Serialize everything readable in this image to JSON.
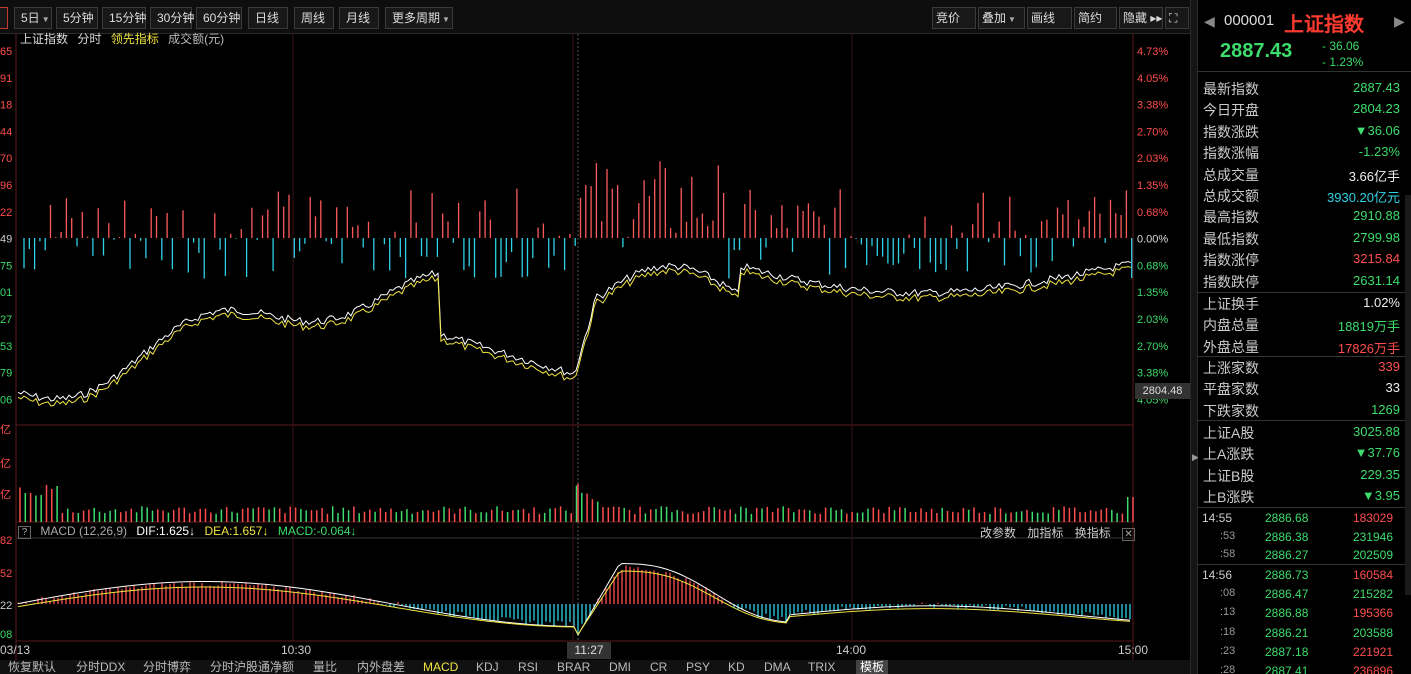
{
  "toolbar": {
    "periods": [
      {
        "label": "5日",
        "caret": true
      },
      {
        "label": "5分钟"
      },
      {
        "label": "15分钟"
      },
      {
        "label": "30分钟"
      },
      {
        "label": "60分钟"
      },
      {
        "label": "日线"
      },
      {
        "label": "周线"
      },
      {
        "label": "月线"
      },
      {
        "label": "更多周期",
        "caret": true
      }
    ],
    "right_tools": [
      {
        "label": "竞价"
      },
      {
        "label": "叠加",
        "caret": true
      },
      {
        "label": "画线"
      },
      {
        "label": "简约"
      },
      {
        "label": "隐藏 ▸▸"
      },
      {
        "label": "⛶"
      }
    ]
  },
  "legend": {
    "name": "上证指数",
    "mode": "分时",
    "leading": "领先指标",
    "volume": "成交额(元)"
  },
  "price_axis_left": [
    "65",
    "91",
    "18",
    "44",
    "70",
    "96",
    "22",
    "49",
    "75",
    "01",
    "27",
    "53",
    "79",
    "06"
  ],
  "pct_axis_right": [
    {
      "v": "4.73%",
      "c": "#ff4d4d"
    },
    {
      "v": "4.05%",
      "c": "#ff4d4d"
    },
    {
      "v": "3.38%",
      "c": "#ff4d4d"
    },
    {
      "v": "2.70%",
      "c": "#ff4d4d"
    },
    {
      "v": "2.03%",
      "c": "#ff4d4d"
    },
    {
      "v": "1.35%",
      "c": "#ff4d4d"
    },
    {
      "v": "0.68%",
      "c": "#ff4d4d"
    },
    {
      "v": "0.00%",
      "c": "#dddddd"
    },
    {
      "v": "0.68%",
      "c": "#3ddc6c"
    },
    {
      "v": "1.35%",
      "c": "#3ddc6c"
    },
    {
      "v": "2.03%",
      "c": "#3ddc6c"
    },
    {
      "v": "2.70%",
      "c": "#3ddc6c"
    },
    {
      "v": "3.38%",
      "c": "#3ddc6c"
    },
    {
      "v": "4.05%",
      "c": "#3ddc6c"
    }
  ],
  "volume_axis_left": [
    "亿",
    "亿",
    "亿"
  ],
  "macd_axis_left": [
    "82",
    "52",
    "22",
    "08"
  ],
  "price_tag": "2804.48",
  "macd": {
    "label": "MACD (12,26,9)",
    "dif": "DIF:1.625↓",
    "dea": "DEA:1.657↓",
    "macd": "MACD:-0.064↓",
    "tools": [
      "改参数",
      "加指标",
      "换指标"
    ]
  },
  "time_axis": [
    "03/13",
    "10:30",
    "14:00",
    "15:00"
  ],
  "time_tag": "11:27",
  "bottom_tabs": [
    {
      "label": "恢复默认"
    },
    {
      "label": "分时DDX"
    },
    {
      "label": "分时博弈"
    },
    {
      "label": "分时沪股通净额"
    },
    {
      "label": "量比"
    },
    {
      "label": "内外盘差"
    },
    {
      "label": "MACD",
      "active": true
    },
    {
      "label": "KDJ"
    },
    {
      "label": "RSI"
    },
    {
      "label": "BRAR"
    },
    {
      "label": "DMI"
    },
    {
      "label": "CR"
    },
    {
      "label": "PSY"
    },
    {
      "label": "KD"
    },
    {
      "label": "DMA"
    },
    {
      "label": "TRIX"
    },
    {
      "label": "模板",
      "sel": true
    }
  ],
  "quote": {
    "code": "000001",
    "name": "上证指数",
    "price": "2887.43",
    "change": "- 36.06",
    "change_pct": "- 1.23%",
    "stats": [
      {
        "label": "最新指数",
        "value": "2887.43",
        "color": "green"
      },
      {
        "label": "今日开盘",
        "value": "2804.23",
        "color": "green"
      },
      {
        "label": "指数涨跌",
        "value": "▼36.06",
        "color": "green"
      },
      {
        "label": "指数涨幅",
        "value": "-1.23%",
        "color": "green"
      },
      {
        "label": "总成交量",
        "value": "3.66亿手",
        "color": "white"
      },
      {
        "label": "总成交额",
        "value": "3930.20亿元",
        "color": "cyan"
      },
      {
        "label": "最高指数",
        "value": "2910.88",
        "color": "green"
      },
      {
        "label": "最低指数",
        "value": "2799.98",
        "color": "green"
      },
      {
        "label": "指数涨停",
        "value": "3215.84",
        "color": "red"
      },
      {
        "label": "指数跌停",
        "value": "2631.14",
        "color": "green"
      }
    ],
    "stats2": [
      {
        "label": "上证换手",
        "value": "1.02%",
        "color": "white"
      },
      {
        "label": "内盘总量",
        "value": "18819万手",
        "color": "green"
      },
      {
        "label": "外盘总量",
        "value": "17826万手",
        "color": "red"
      }
    ],
    "stats3": [
      {
        "label": "上涨家数",
        "value": "339",
        "color": "red"
      },
      {
        "label": "平盘家数",
        "value": "33",
        "color": "white"
      },
      {
        "label": "下跌家数",
        "value": "1269",
        "color": "green"
      }
    ],
    "stats4": [
      {
        "label": "上证A股",
        "value": "3025.88",
        "color": "green"
      },
      {
        "label": "上A涨跌",
        "value": "▼37.76",
        "color": "green"
      },
      {
        "label": "上证B股",
        "value": "229.35",
        "color": "green"
      },
      {
        "label": "上B涨跌",
        "value": "▼3.95",
        "color": "green"
      }
    ]
  },
  "ticks": [
    {
      "t": "14:55",
      "p": "2886.68",
      "v": "183029",
      "c": "red",
      "big": true
    },
    {
      "t": ":53",
      "p": "2886.38",
      "v": "231946",
      "c": "green"
    },
    {
      "t": ":58",
      "p": "2886.27",
      "v": "202509",
      "c": "green"
    },
    {
      "t": "14:56",
      "p": "2886.73",
      "v": "160584",
      "c": "red",
      "big": true
    },
    {
      "t": ":08",
      "p": "2886.47",
      "v": "215282",
      "c": "green"
    },
    {
      "t": ":13",
      "p": "2886.88",
      "v": "195366",
      "c": "red"
    },
    {
      "t": ":18",
      "p": "2886.21",
      "v": "203588",
      "c": "green"
    },
    {
      "t": ":23",
      "p": "2887.18",
      "v": "221921",
      "c": "red"
    },
    {
      "t": ":28",
      "p": "2887.41",
      "v": "236896",
      "c": "red"
    }
  ]
}
